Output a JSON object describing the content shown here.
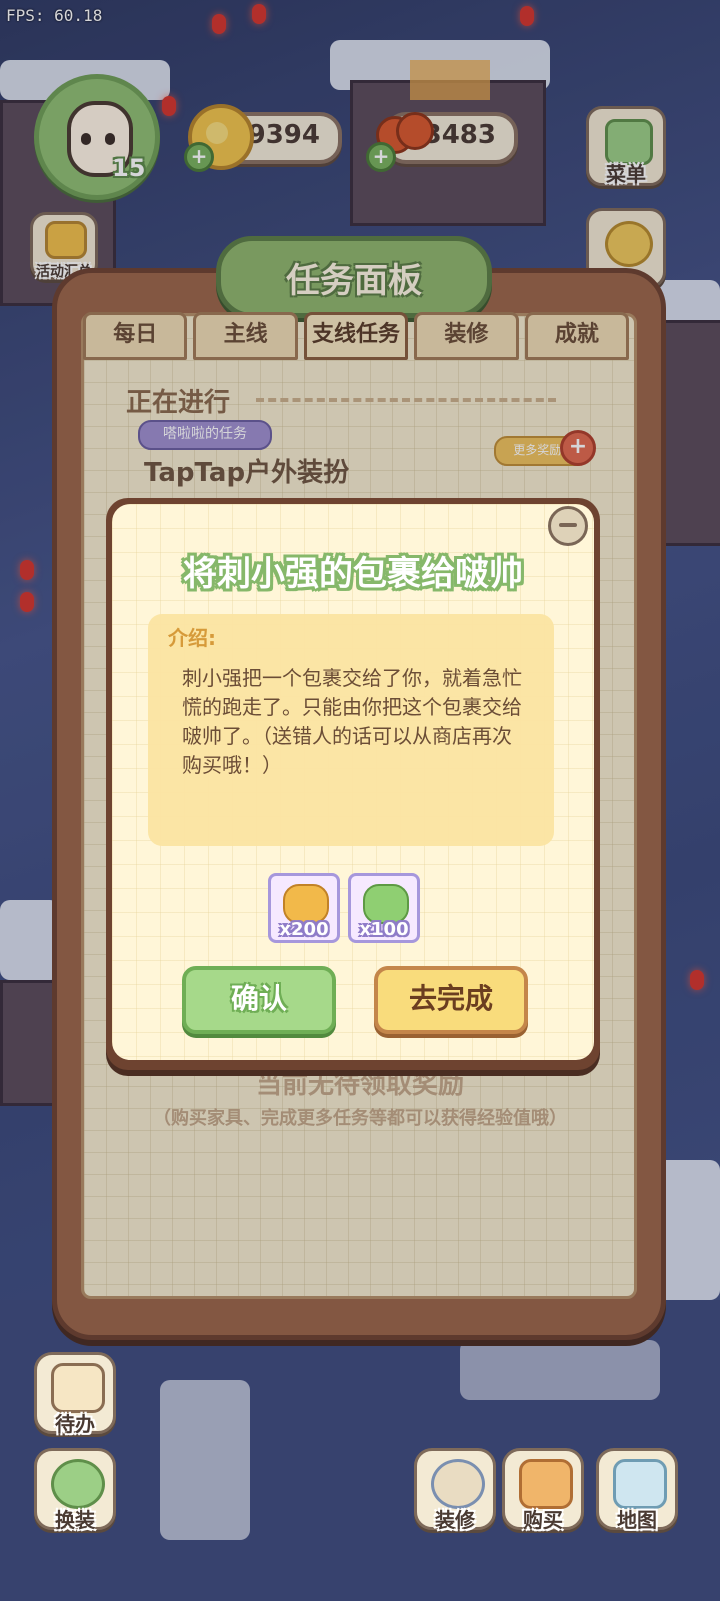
{
  "fps": "FPS: 60.18",
  "player": {
    "level": "15"
  },
  "currency": {
    "coins": "9394",
    "fruit": "3483"
  },
  "side_buttons": {
    "menu": "菜单",
    "events": "活动汇总"
  },
  "panel": {
    "title": "任务面板",
    "tabs": [
      "每日",
      "主线",
      "支线任务",
      "装修",
      "成就"
    ],
    "active_tab": 2,
    "section": "正在进行",
    "task_chip": "嗒啦啦的任务",
    "task_name": "TapTap户外装扮",
    "more_rewards": "更多奖励!!",
    "no_reward": "当前无待领取奖励",
    "hint": "（购买家具、完成更多任务等都可以获得经验值哦）"
  },
  "dialog": {
    "title": "将刺小强的包裹给啵帅",
    "intro_label": "介绍:",
    "intro_text": "刺小强把一个包裹交给了你，就着急忙慌的跑走了。只能由你把这个包裹交给啵帅了。（送错人的话可以从商店再次购买哦！）",
    "rewards": [
      {
        "icon": "gold-pile-icon",
        "count": "x200"
      },
      {
        "icon": "green-leaf-icon",
        "count": "x100"
      }
    ],
    "confirm": "确认",
    "go_complete": "去完成"
  },
  "bottom_buttons": {
    "todo": "待办",
    "dress": "换装",
    "decorate": "装修",
    "shop": "购买",
    "map": "地图"
  },
  "colors": {
    "panel_wood": "#9b6648",
    "title_green": "#8fb66c",
    "confirm_green": "#a6d98a",
    "go_yellow": "#f9dc7c"
  }
}
